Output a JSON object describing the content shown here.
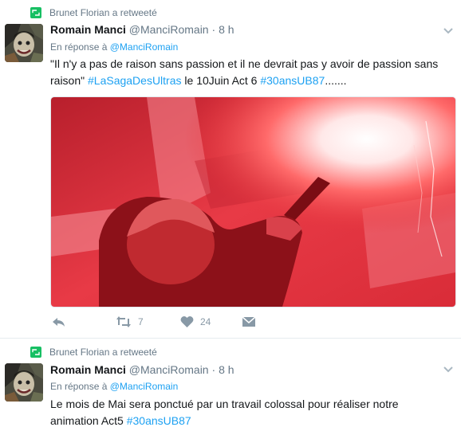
{
  "tweets": [
    {
      "retweeter": "Brunet Florian a retweeté",
      "name": "Romain Manci",
      "handle": "@ManciRomain",
      "dot": "·",
      "time": "8 h",
      "reply_prefix": "En réponse à",
      "reply_handle": "@ManciRomain",
      "text_part1": "\"Il n'y a pas de raison sans passion et il ne devrait pas y avoir de passion sans raison\" ",
      "hashtag1": "#LaSagaDesUltras",
      "text_part2": " le 10Juin Act 6 ",
      "hashtag2": "#30ansUB87",
      "text_part3": ".......",
      "actions": {
        "reply_count": "",
        "retweet_count": "7",
        "like_count": "24"
      },
      "image_icon": "flare-photo"
    },
    {
      "retweeter": "Brunet Florian a retweeté",
      "name": "Romain Manci",
      "handle": "@ManciRomain",
      "dot": "·",
      "time": "8 h",
      "reply_prefix": "En réponse à",
      "reply_handle": "@ManciRomain",
      "text_part1": "Le mois de Mai sera ponctué par un travail colossal pour réaliser notre animation Act5 ",
      "hashtag1": "#30ansUB87"
    }
  ],
  "colors": {
    "accent": "#1da1f2",
    "retweet": "#17bf63",
    "muted": "#657786",
    "icon": "#8899a6"
  }
}
